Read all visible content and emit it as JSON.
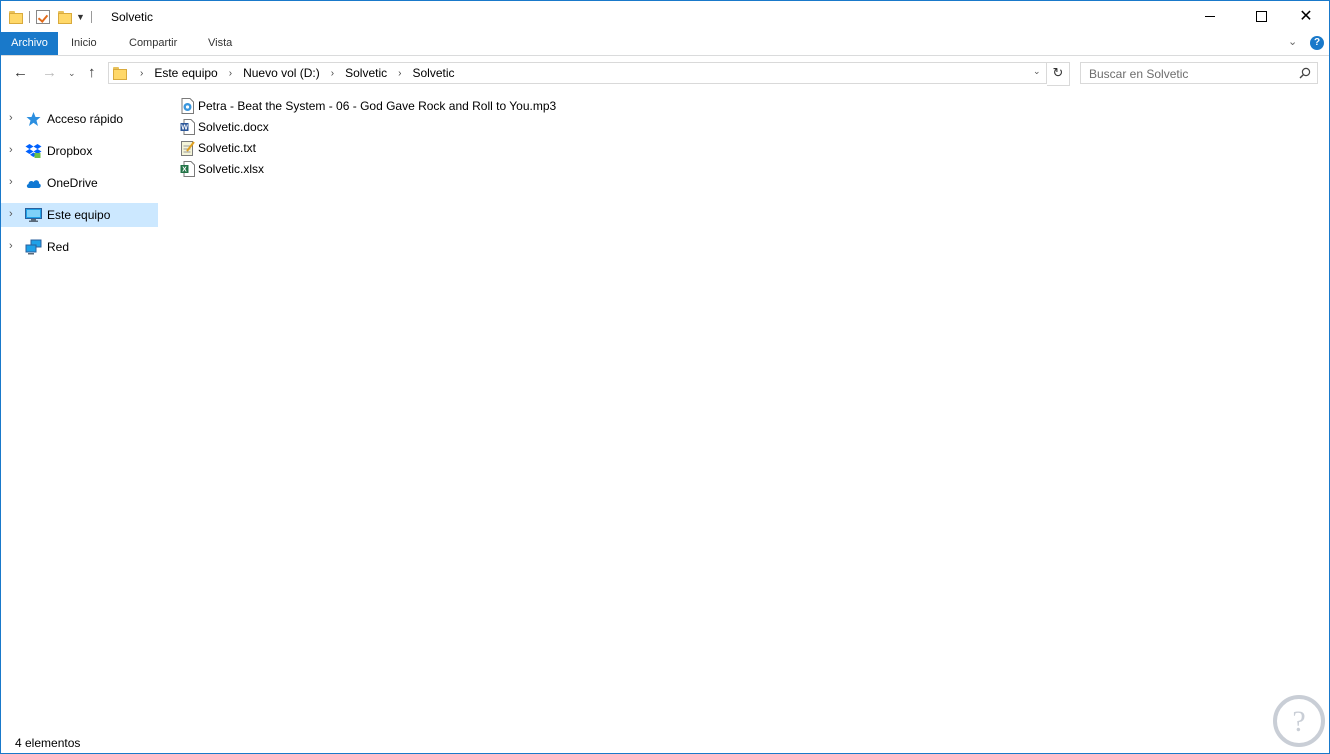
{
  "window": {
    "title": "Solvetic",
    "accent_color": "#1979ca"
  },
  "ribbon": {
    "tabs": [
      {
        "label": "Archivo"
      },
      {
        "label": "Inicio"
      },
      {
        "label": "Compartir"
      },
      {
        "label": "Vista"
      }
    ]
  },
  "navigation": {
    "breadcrumb": [
      "Este equipo",
      "Nuevo vol (D:)",
      "Solvetic",
      "Solvetic"
    ],
    "search_placeholder": "Buscar en Solvetic"
  },
  "sidebar": {
    "items": [
      {
        "label": "Acceso rápido",
        "icon": "star-icon",
        "selected": false
      },
      {
        "label": "Dropbox",
        "icon": "dropbox-icon",
        "selected": false
      },
      {
        "label": "OneDrive",
        "icon": "cloud-icon",
        "selected": false
      },
      {
        "label": "Este equipo",
        "icon": "computer-icon",
        "selected": true
      },
      {
        "label": "Red",
        "icon": "network-icon",
        "selected": false
      }
    ]
  },
  "files": [
    {
      "name": "Petra - Beat the System - 06 - God Gave Rock and Roll to You.mp3",
      "icon": "audio-file-icon"
    },
    {
      "name": "Solvetic.docx",
      "icon": "word-file-icon"
    },
    {
      "name": "Solvetic.txt",
      "icon": "text-file-icon"
    },
    {
      "name": "Solvetic.xlsx",
      "icon": "excel-file-icon"
    }
  ],
  "status": {
    "item_count": "4 elementos"
  }
}
